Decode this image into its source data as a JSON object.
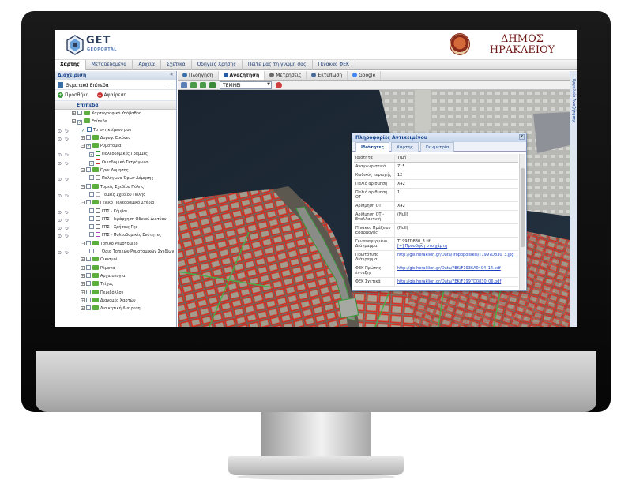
{
  "app": {
    "logo_text": "GET",
    "logo_sub": "GEOPORTAL",
    "municipality_line1": "ΔΗΜΟΣ",
    "municipality_line2": "ΗΡΑΚΛΕΙΟΥ"
  },
  "menu": [
    {
      "label": "Χάρτης",
      "active": true
    },
    {
      "label": "Μεταδεδομένα",
      "active": false
    },
    {
      "label": "Αρχεία",
      "active": false
    },
    {
      "label": "Σχετικά",
      "active": false
    },
    {
      "label": "Οδηγίες Χρήσης",
      "active": false
    },
    {
      "label": "Πείτε μας τη γνώμη σας",
      "active": false
    },
    {
      "label": "Πίνακας ΦΕΚ",
      "active": false
    }
  ],
  "sidebar": {
    "header": "Διαχείριση",
    "collapse": "«",
    "layers_title": "Θεματικά Επίπεδα",
    "add_label": "Προσθήκη",
    "remove_label": "Αφαίρεση",
    "column_header": "Επίπεδα",
    "tree": [
      {
        "label": "Χαρτογραφικό Υπόβαθρο",
        "level": 1,
        "type": "folder",
        "expand": "+",
        "controls": false
      },
      {
        "label": "Επίπεδα",
        "level": 1,
        "type": "folder",
        "expand": "−",
        "controls": false,
        "checked": true
      },
      {
        "label": "Το αντικείμενό μου",
        "level": 2,
        "type": "leaf",
        "controls": true,
        "checked": true,
        "color": "#3a6ea8"
      },
      {
        "label": "Δορυφ. Εικόνες",
        "level": 2,
        "type": "folder",
        "expand": "+",
        "controls": true
      },
      {
        "label": "Ρυμοτομία",
        "level": 2,
        "type": "folder",
        "expand": "−",
        "controls": false,
        "checked": true
      },
      {
        "label": "Πολεοδομικές Γραμμές",
        "level": 3,
        "type": "leaf",
        "controls": true,
        "checked": true,
        "color": "#2e9a2e"
      },
      {
        "label": "Οικοδομικό Τετράγωνο",
        "level": 3,
        "type": "leaf",
        "controls": true,
        "checked": true,
        "color": "#d0302a"
      },
      {
        "label": "Όροι Δόμησης",
        "level": 2,
        "type": "folder",
        "expand": "−",
        "controls": false
      },
      {
        "label": "Πολύγωνα Όρων Δόμησης",
        "level": 3,
        "type": "leaf",
        "controls": true,
        "checked": false,
        "color": "#888888"
      },
      {
        "label": "Τομείς Σχεδίου Πόλης",
        "level": 2,
        "type": "folder",
        "expand": "−",
        "controls": false
      },
      {
        "label": "Τομείς Σχεδίου Πόλης",
        "level": 3,
        "type": "leaf",
        "controls": true,
        "checked": false,
        "color": "#aaaaaa"
      },
      {
        "label": "Γενικό Πολεοδομικό Σχέδιο",
        "level": 2,
        "type": "folder",
        "expand": "−",
        "controls": false
      },
      {
        "label": "ΓΠΣ - Κόμβοι",
        "level": 3,
        "type": "leaf",
        "controls": true,
        "checked": false,
        "color": "#777777"
      },
      {
        "label": "ΓΠΣ - Ιεράρχηση Οδικού Δικτύου",
        "level": 3,
        "type": "leaf",
        "controls": true,
        "checked": false,
        "color": "#777777"
      },
      {
        "label": "ΓΠΣ - Χρήσεις Γης",
        "level": 3,
        "type": "leaf",
        "controls": true,
        "checked": false,
        "color": "#777777"
      },
      {
        "label": "ΓΠΣ - Πολεοδομικές Ενότητες",
        "level": 3,
        "type": "leaf",
        "controls": true,
        "checked": false,
        "color": "#b040c0"
      },
      {
        "label": "Τοπικό Ρυμοτομικό",
        "level": 2,
        "type": "folder",
        "expand": "−",
        "controls": false
      },
      {
        "label": "Όρια Τοπικών Ρυμοτομικών Σχεδίων",
        "level": 3,
        "type": "leaf",
        "controls": true,
        "checked": false,
        "color": "#777777"
      },
      {
        "label": "Οικισμοί",
        "level": 2,
        "type": "folder",
        "expand": "+",
        "controls": false
      },
      {
        "label": "Ρέματα",
        "level": 2,
        "type": "folder",
        "expand": "+",
        "controls": false
      },
      {
        "label": "Αρχαιολογία",
        "level": 2,
        "type": "folder",
        "expand": "+",
        "controls": false
      },
      {
        "label": "Τείχος",
        "level": 2,
        "type": "folder",
        "expand": "+",
        "controls": false
      },
      {
        "label": "Περιβόλλον",
        "level": 2,
        "type": "folder",
        "expand": "+",
        "controls": false
      },
      {
        "label": "Διανομές Χαρτών",
        "level": 2,
        "type": "folder",
        "expand": "+",
        "controls": false
      },
      {
        "label": "Διοικητική Διαίρεση",
        "level": 2,
        "type": "folder",
        "expand": "+",
        "controls": false
      }
    ]
  },
  "map_toolbar": [
    {
      "label": "Πλοήγηση",
      "icon": "navigate-icon",
      "color": "#3a6ea8"
    },
    {
      "label": "Αναζήτηση",
      "icon": "search-icon",
      "color": "#2a5aa0",
      "active": true
    },
    {
      "label": "Μετρήσεις",
      "icon": "ruler-icon",
      "color": "#6a6a6a"
    },
    {
      "label": "Εκτύπωση",
      "icon": "printer-icon",
      "color": "#4a6a9a"
    },
    {
      "label": "Google",
      "icon": "google-icon",
      "color": "#4285f4"
    }
  ],
  "map_subtools": {
    "select_value": "ΤΕΜΝΕΙ"
  },
  "right_strip_label": "Εργαλεία Αναζήτησης",
  "popup": {
    "title": "Πληροφορίες Αντικειμένου",
    "close": "x",
    "tabs": [
      {
        "label": "Ιδιότητες",
        "active": true
      },
      {
        "label": "Χάρτης",
        "active": false
      },
      {
        "label": "Γεωμετρία",
        "active": false
      }
    ],
    "header": {
      "key": "Ιδιότητα",
      "value": "Τιμή"
    },
    "rows": [
      {
        "key": "Αναγνωριστικό",
        "value": "715",
        "link": false
      },
      {
        "key": "Κωδικός περιοχής",
        "value": "12",
        "link": false
      },
      {
        "key": "Παλιό αριθμηση",
        "value": "X42",
        "link": false
      },
      {
        "key": "Παλιό αριθμηση ΟΤ",
        "value": "1",
        "link": false
      },
      {
        "key": "Αρίθμηση ΟΤ",
        "value": "X42",
        "link": false
      },
      {
        "key": "Αρίθμηση ΟΤ - Εναλλακτική",
        "value": "(Null)",
        "link": false
      },
      {
        "key": "Πίνακες Πράξεων Εφαρμογής",
        "value": "(Null)",
        "link": false
      },
      {
        "key": "Γεωαναφερμένο Διάγραμμα",
        "value": "T1997D830_3.tif",
        "value2": "[+] Προσθήκη στο χάρτη",
        "link": false
      },
      {
        "key": "Πρωτότυπο Διάγραμμα",
        "value": "http://gis.heraklion.gr/Data/Tropopoiiseis/T1997D830_3.jpg",
        "link": true
      },
      {
        "key": "ΦΕΚ Πρώτης ένταξης",
        "value": "http://gis.heraklion.gr/Data/FEK/F1936A0404_14.pdf",
        "link": true
      },
      {
        "key": "ΦΕΚ Σχετικά",
        "value": "http://gis.heraklion.gr/Data/FEK/F1997D0830_06.pdf",
        "link": true
      }
    ]
  }
}
